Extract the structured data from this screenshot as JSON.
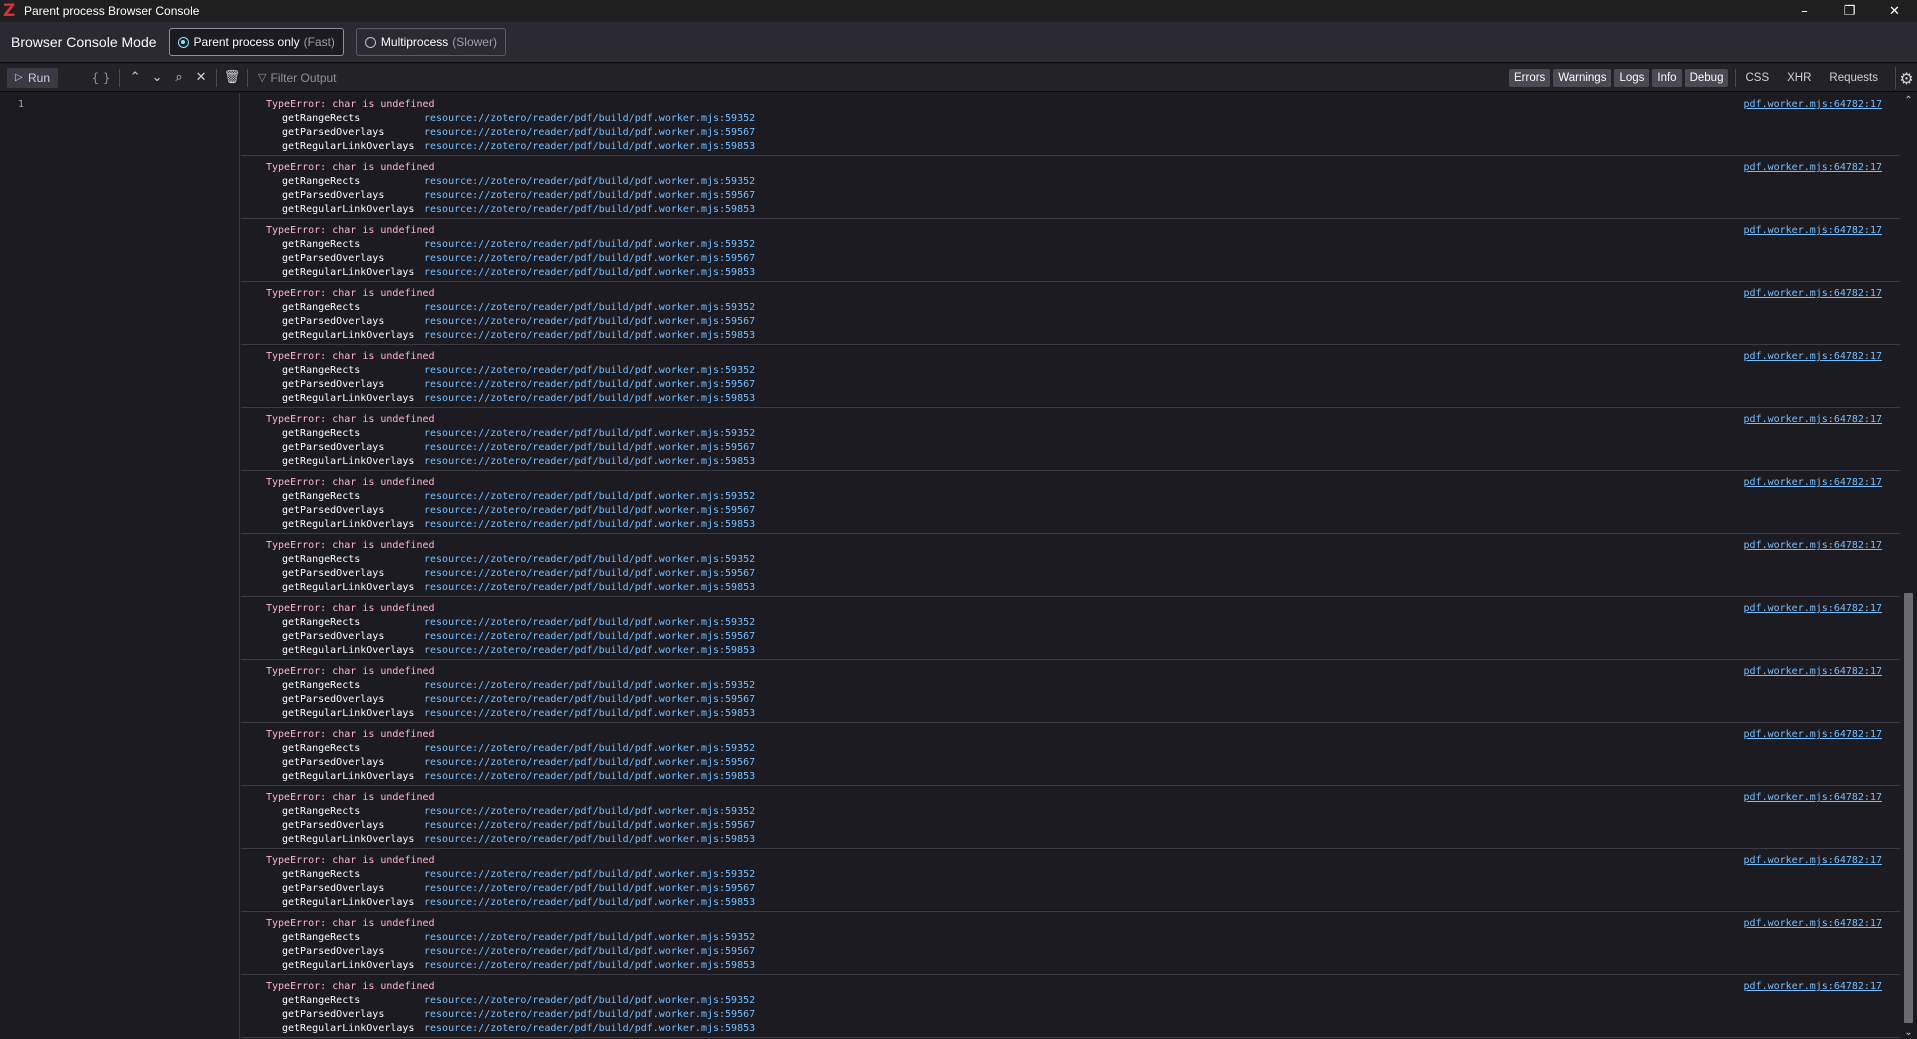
{
  "window": {
    "title": "Parent process Browser Console",
    "logo": "Z",
    "minimize_icon": "minimize-icon",
    "restore_icon": "restore-icon",
    "close_icon": "close-icon"
  },
  "mode_bar": {
    "label": "Browser Console Mode",
    "options": [
      {
        "label": "Parent process only",
        "hint": "(Fast)",
        "selected": true
      },
      {
        "label": "Multiprocess",
        "hint": "(Slower)",
        "selected": false
      }
    ]
  },
  "toolbar": {
    "run_label": "Run",
    "braces_label": "{ }",
    "filter_placeholder": "Filter Output",
    "filters": [
      {
        "label": "Errors",
        "checked": true
      },
      {
        "label": "Warnings",
        "checked": true
      },
      {
        "label": "Logs",
        "checked": true
      },
      {
        "label": "Info",
        "checked": true
      },
      {
        "label": "Debug",
        "checked": true
      },
      {
        "label": "CSS",
        "checked": false
      },
      {
        "label": "XHR",
        "checked": false
      },
      {
        "label": "Requests",
        "checked": false
      }
    ]
  },
  "editor": {
    "line_number": "1"
  },
  "messages": [
    {
      "text": "TypeError: char is undefined",
      "location": "pdf.worker.mjs:64782:17",
      "frames": [
        {
          "fn": "getRangeRects",
          "src": "resource://zotero/reader/pdf/build/pdf.worker.mjs:59352"
        },
        {
          "fn": "getParsedOverlays",
          "src": "resource://zotero/reader/pdf/build/pdf.worker.mjs:59567"
        },
        {
          "fn": "getRegularLinkOverlays",
          "src": "resource://zotero/reader/pdf/build/pdf.worker.mjs:59853"
        }
      ]
    },
    {
      "text": "TypeError: char is undefined",
      "location": "pdf.worker.mjs:64782:17",
      "frames": [
        {
          "fn": "getRangeRects",
          "src": "resource://zotero/reader/pdf/build/pdf.worker.mjs:59352"
        },
        {
          "fn": "getParsedOverlays",
          "src": "resource://zotero/reader/pdf/build/pdf.worker.mjs:59567"
        },
        {
          "fn": "getRegularLinkOverlays",
          "src": "resource://zotero/reader/pdf/build/pdf.worker.mjs:59853"
        }
      ]
    },
    {
      "text": "TypeError: char is undefined",
      "location": "pdf.worker.mjs:64782:17",
      "frames": [
        {
          "fn": "getRangeRects",
          "src": "resource://zotero/reader/pdf/build/pdf.worker.mjs:59352"
        },
        {
          "fn": "getParsedOverlays",
          "src": "resource://zotero/reader/pdf/build/pdf.worker.mjs:59567"
        },
        {
          "fn": "getRegularLinkOverlays",
          "src": "resource://zotero/reader/pdf/build/pdf.worker.mjs:59853"
        }
      ]
    },
    {
      "text": "TypeError: char is undefined",
      "location": "pdf.worker.mjs:64782:17",
      "frames": [
        {
          "fn": "getRangeRects",
          "src": "resource://zotero/reader/pdf/build/pdf.worker.mjs:59352"
        },
        {
          "fn": "getParsedOverlays",
          "src": "resource://zotero/reader/pdf/build/pdf.worker.mjs:59567"
        },
        {
          "fn": "getRegularLinkOverlays",
          "src": "resource://zotero/reader/pdf/build/pdf.worker.mjs:59853"
        }
      ]
    },
    {
      "text": "TypeError: char is undefined",
      "location": "pdf.worker.mjs:64782:17",
      "frames": [
        {
          "fn": "getRangeRects",
          "src": "resource://zotero/reader/pdf/build/pdf.worker.mjs:59352"
        },
        {
          "fn": "getParsedOverlays",
          "src": "resource://zotero/reader/pdf/build/pdf.worker.mjs:59567"
        },
        {
          "fn": "getRegularLinkOverlays",
          "src": "resource://zotero/reader/pdf/build/pdf.worker.mjs:59853"
        }
      ]
    },
    {
      "text": "TypeError: char is undefined",
      "location": "pdf.worker.mjs:64782:17",
      "frames": [
        {
          "fn": "getRangeRects",
          "src": "resource://zotero/reader/pdf/build/pdf.worker.mjs:59352"
        },
        {
          "fn": "getParsedOverlays",
          "src": "resource://zotero/reader/pdf/build/pdf.worker.mjs:59567"
        },
        {
          "fn": "getRegularLinkOverlays",
          "src": "resource://zotero/reader/pdf/build/pdf.worker.mjs:59853"
        }
      ]
    },
    {
      "text": "TypeError: char is undefined",
      "location": "pdf.worker.mjs:64782:17",
      "frames": [
        {
          "fn": "getRangeRects",
          "src": "resource://zotero/reader/pdf/build/pdf.worker.mjs:59352"
        },
        {
          "fn": "getParsedOverlays",
          "src": "resource://zotero/reader/pdf/build/pdf.worker.mjs:59567"
        },
        {
          "fn": "getRegularLinkOverlays",
          "src": "resource://zotero/reader/pdf/build/pdf.worker.mjs:59853"
        }
      ]
    },
    {
      "text": "TypeError: char is undefined",
      "location": "pdf.worker.mjs:64782:17",
      "frames": [
        {
          "fn": "getRangeRects",
          "src": "resource://zotero/reader/pdf/build/pdf.worker.mjs:59352"
        },
        {
          "fn": "getParsedOverlays",
          "src": "resource://zotero/reader/pdf/build/pdf.worker.mjs:59567"
        },
        {
          "fn": "getRegularLinkOverlays",
          "src": "resource://zotero/reader/pdf/build/pdf.worker.mjs:59853"
        }
      ]
    },
    {
      "text": "TypeError: char is undefined",
      "location": "pdf.worker.mjs:64782:17",
      "frames": [
        {
          "fn": "getRangeRects",
          "src": "resource://zotero/reader/pdf/build/pdf.worker.mjs:59352"
        },
        {
          "fn": "getParsedOverlays",
          "src": "resource://zotero/reader/pdf/build/pdf.worker.mjs:59567"
        },
        {
          "fn": "getRegularLinkOverlays",
          "src": "resource://zotero/reader/pdf/build/pdf.worker.mjs:59853"
        }
      ]
    },
    {
      "text": "TypeError: char is undefined",
      "location": "pdf.worker.mjs:64782:17",
      "frames": [
        {
          "fn": "getRangeRects",
          "src": "resource://zotero/reader/pdf/build/pdf.worker.mjs:59352"
        },
        {
          "fn": "getParsedOverlays",
          "src": "resource://zotero/reader/pdf/build/pdf.worker.mjs:59567"
        },
        {
          "fn": "getRegularLinkOverlays",
          "src": "resource://zotero/reader/pdf/build/pdf.worker.mjs:59853"
        }
      ]
    },
    {
      "text": "TypeError: char is undefined",
      "location": "pdf.worker.mjs:64782:17",
      "frames": [
        {
          "fn": "getRangeRects",
          "src": "resource://zotero/reader/pdf/build/pdf.worker.mjs:59352"
        },
        {
          "fn": "getParsedOverlays",
          "src": "resource://zotero/reader/pdf/build/pdf.worker.mjs:59567"
        },
        {
          "fn": "getRegularLinkOverlays",
          "src": "resource://zotero/reader/pdf/build/pdf.worker.mjs:59853"
        }
      ]
    },
    {
      "text": "TypeError: char is undefined",
      "location": "pdf.worker.mjs:64782:17",
      "frames": [
        {
          "fn": "getRangeRects",
          "src": "resource://zotero/reader/pdf/build/pdf.worker.mjs:59352"
        },
        {
          "fn": "getParsedOverlays",
          "src": "resource://zotero/reader/pdf/build/pdf.worker.mjs:59567"
        },
        {
          "fn": "getRegularLinkOverlays",
          "src": "resource://zotero/reader/pdf/build/pdf.worker.mjs:59853"
        }
      ]
    },
    {
      "text": "TypeError: char is undefined",
      "location": "pdf.worker.mjs:64782:17",
      "frames": [
        {
          "fn": "getRangeRects",
          "src": "resource://zotero/reader/pdf/build/pdf.worker.mjs:59352"
        },
        {
          "fn": "getParsedOverlays",
          "src": "resource://zotero/reader/pdf/build/pdf.worker.mjs:59567"
        },
        {
          "fn": "getRegularLinkOverlays",
          "src": "resource://zotero/reader/pdf/build/pdf.worker.mjs:59853"
        }
      ]
    },
    {
      "text": "TypeError: char is undefined",
      "location": "pdf.worker.mjs:64782:17",
      "frames": [
        {
          "fn": "getRangeRects",
          "src": "resource://zotero/reader/pdf/build/pdf.worker.mjs:59352"
        },
        {
          "fn": "getParsedOverlays",
          "src": "resource://zotero/reader/pdf/build/pdf.worker.mjs:59567"
        },
        {
          "fn": "getRegularLinkOverlays",
          "src": "resource://zotero/reader/pdf/build/pdf.worker.mjs:59853"
        }
      ]
    },
    {
      "text": "TypeError: char is undefined",
      "location": "pdf.worker.mjs:64782:17",
      "frames": [
        {
          "fn": "getRangeRects",
          "src": "resource://zotero/reader/pdf/build/pdf.worker.mjs:59352"
        },
        {
          "fn": "getParsedOverlays",
          "src": "resource://zotero/reader/pdf/build/pdf.worker.mjs:59567"
        },
        {
          "fn": "getRegularLinkOverlays",
          "src": "resource://zotero/reader/pdf/build/pdf.worker.mjs:59853"
        }
      ]
    }
  ],
  "colors": {
    "error_text": "#ffb3d2",
    "link": "#75bfff",
    "background": "#1c1b22",
    "brand": "#db2c3a"
  }
}
